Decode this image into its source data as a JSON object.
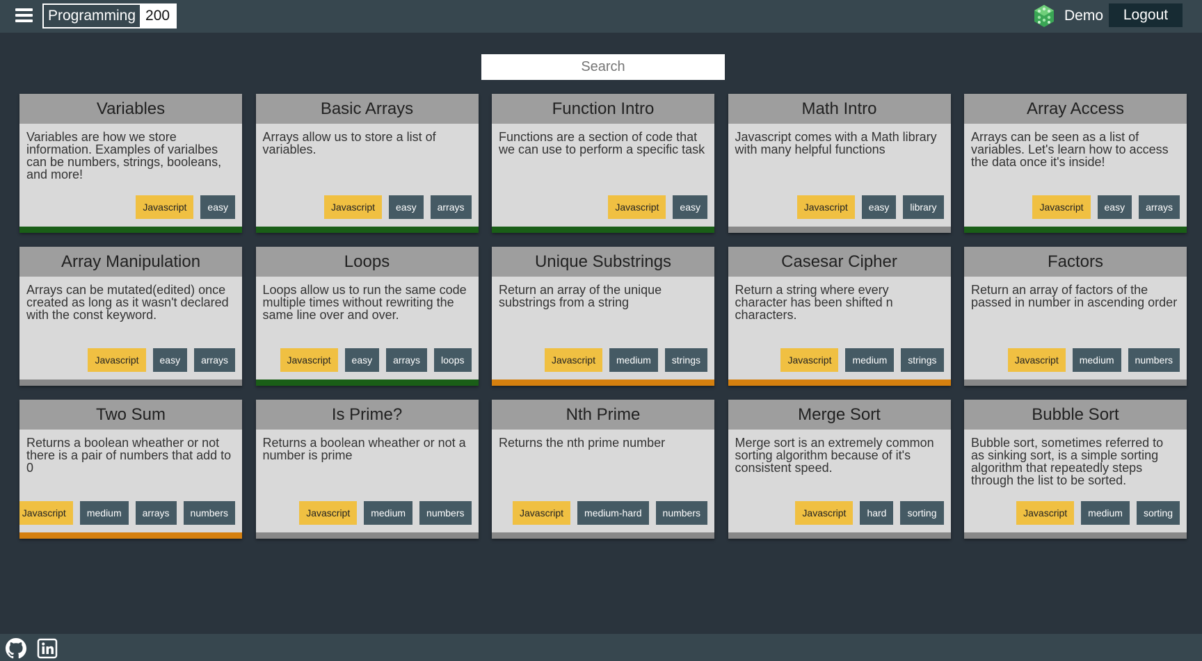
{
  "header": {
    "brand_name": "Programming",
    "brand_count": "200",
    "user_name": "Demo",
    "logout_label": "Logout"
  },
  "search": {
    "placeholder": "Search"
  },
  "colors": {
    "easy": "#1a5e17",
    "medium": "#d5800f",
    "none": "#888888"
  },
  "cards": [
    {
      "title": "Variables",
      "desc": "Variables are how we store information. Examples of varialbes can be numbers, strings, booleans, and more!",
      "tags": [
        "Javascript",
        "easy"
      ],
      "bar": "easy"
    },
    {
      "title": "Basic Arrays",
      "desc": "Arrays allow us to store a list of variables.",
      "tags": [
        "Javascript",
        "easy",
        "arrays"
      ],
      "bar": "easy"
    },
    {
      "title": "Function Intro",
      "desc": "Functions are a section of code that we can use to perform a specific task",
      "tags": [
        "Javascript",
        "easy"
      ],
      "bar": "easy"
    },
    {
      "title": "Math Intro",
      "desc": "Javascript comes with a Math library with many helpful functions",
      "tags": [
        "Javascript",
        "easy",
        "library"
      ],
      "bar": "none"
    },
    {
      "title": "Array Access",
      "desc": "Arrays can be seen as a list of variables. Let's learn how to access the data once it's inside!",
      "tags": [
        "Javascript",
        "easy",
        "arrays"
      ],
      "bar": "easy"
    },
    {
      "title": "Array Manipulation",
      "desc": "Arrays can be mutated(edited) once created as long as it wasn't declared with the const keyword.",
      "tags": [
        "Javascript",
        "easy",
        "arrays"
      ],
      "bar": "none"
    },
    {
      "title": "Loops",
      "desc": "Loops allow us to run the same code multiple times without rewriting the same line over and over.",
      "tags": [
        "Javascript",
        "easy",
        "arrays",
        "loops"
      ],
      "bar": "easy"
    },
    {
      "title": "Unique Substrings",
      "desc": "Return an array of the unique substrings from a string",
      "tags": [
        "Javascript",
        "medium",
        "strings"
      ],
      "bar": "medium"
    },
    {
      "title": "Casesar Cipher",
      "desc": "Return a string where every character has been shifted n characters.",
      "tags": [
        "Javascript",
        "medium",
        "strings"
      ],
      "bar": "medium"
    },
    {
      "title": "Factors",
      "desc": "Return an array of factors of the passed in number in ascending order",
      "tags": [
        "Javascript",
        "medium",
        "numbers"
      ],
      "bar": "none"
    },
    {
      "title": "Two Sum",
      "desc": "Returns a boolean wheather or not there is a pair of numbers that add to 0",
      "tags": [
        "Javascript",
        "medium",
        "arrays",
        "numbers"
      ],
      "bar": "medium"
    },
    {
      "title": "Is Prime?",
      "desc": "Returns a boolean wheather or not a number is prime",
      "tags": [
        "Javascript",
        "medium",
        "numbers"
      ],
      "bar": "none"
    },
    {
      "title": "Nth Prime",
      "desc": "Returns the nth prime number",
      "tags": [
        "Javascript",
        "medium-hard",
        "numbers"
      ],
      "bar": "none"
    },
    {
      "title": "Merge Sort",
      "desc": "Merge sort is an extremely common sorting algorithm because of it's consistent speed.",
      "tags": [
        "Javascript",
        "hard",
        "sorting"
      ],
      "bar": "none"
    },
    {
      "title": "Bubble Sort",
      "desc": "Bubble sort, sometimes referred to as sinking sort, is a simple sorting algorithm that repeatedly steps through the list to be sorted.",
      "tags": [
        "Javascript",
        "medium",
        "sorting"
      ],
      "bar": "none"
    }
  ],
  "footer": {
    "icons": [
      "github-icon",
      "linkedin-icon"
    ]
  }
}
